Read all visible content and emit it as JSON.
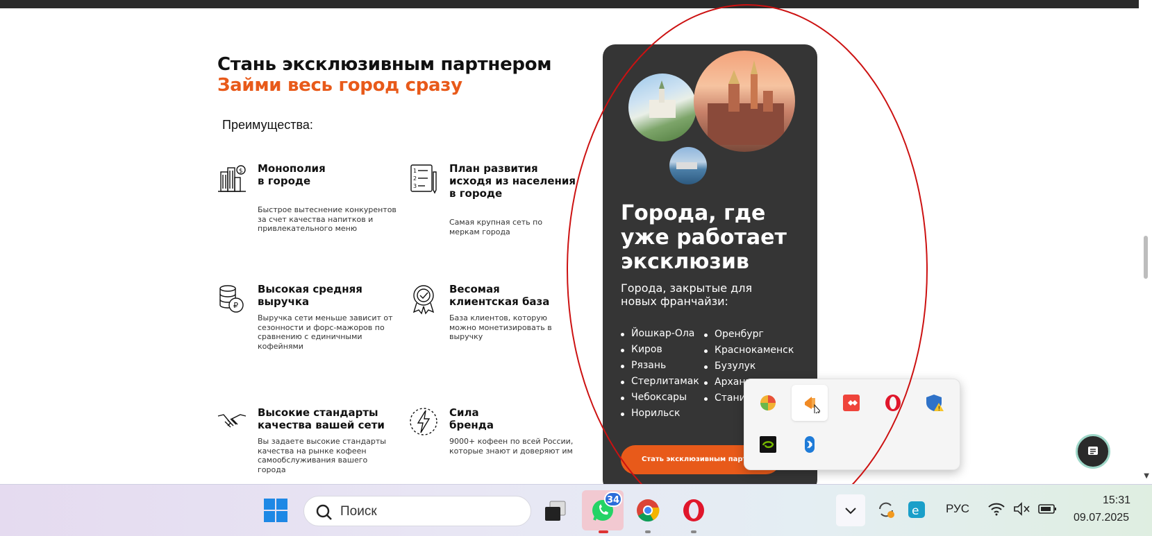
{
  "headline": {
    "line1": "Стань эксклюзивным партнером",
    "line2": "Займи весь город сразу"
  },
  "advantages_label": "Преимущества:",
  "features": [
    {
      "icon": "city-building-icon",
      "title": "Монополия\nв городе",
      "desc": "Быстрое вытеснение конкурентов\nза счет качества напитков и\nпривлекательного меню"
    },
    {
      "icon": "checklist-icon",
      "title": "План развития\nисходя из населения\nв городе",
      "desc": "Самая крупная сеть по\nмеркам города"
    },
    {
      "icon": "coin-stack-icon",
      "title": "Высокая средняя\nвыручка",
      "desc": "Выручка сети меньше зависит от\nсезонности и форс-мажоров по\nсравнению с единичными\nкофейнями"
    },
    {
      "icon": "award-badge-icon",
      "title": "Весомая\nклиентская база",
      "desc": "База клиентов, которую\nможно монетизировать в\nвыручку"
    },
    {
      "icon": "handshake-icon",
      "title": "Высокие стандарты\nкачества вашей сети",
      "desc": "Вы задаете высокие стандарты\nкачества на рынке кофеен\nсамообслуживания вашего\nгорода"
    },
    {
      "icon": "lightning-icon",
      "title": "Сила\nбренда",
      "desc": "9000+ кофеен по всей России,\nкоторые знают и доверяют им"
    }
  ],
  "card": {
    "title": "Города, где\nуже работает\nэксклюзив",
    "subtitle": "Города, закрытые для\nновых франчайзи:",
    "cities_left": [
      "Йошкар-Ола",
      "Киров",
      "Рязань",
      "Стерлитамак",
      "Чебоксары",
      "Норильск"
    ],
    "cities_right": [
      "Оренбург",
      "Краснокаменск",
      "Бузулук",
      "Арханг",
      "Стани"
    ],
    "cta": "Стать эксклюзивным партнером"
  },
  "tray_icons": [
    "multicolor-ball-icon",
    "orange-app-icon",
    "anydesk-icon",
    "opera-icon",
    "security-shield-icon",
    "nvidia-icon",
    "bluetooth-icon"
  ],
  "taskbar": {
    "search_placeholder": "Поиск",
    "whatsapp_badge": "34",
    "language": "РУС",
    "time": "15:31",
    "date": "09.07.2025"
  },
  "colors": {
    "accent": "#e85a1a",
    "card_bg": "#353535",
    "annotation": "#cc1111"
  }
}
